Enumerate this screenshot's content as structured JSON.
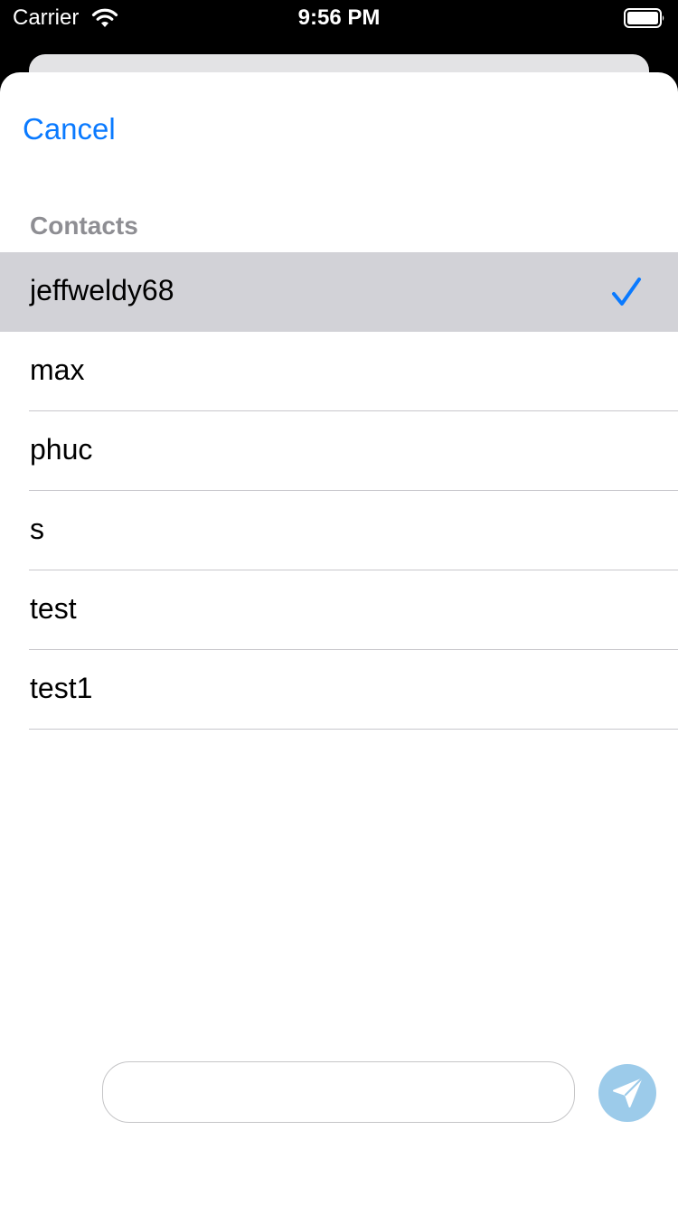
{
  "status_bar": {
    "carrier": "Carrier",
    "time": "9:56 PM",
    "wifi_icon": "wifi-icon",
    "battery_icon": "battery-icon"
  },
  "header": {
    "cancel_label": "Cancel"
  },
  "contacts": {
    "section_title": "Contacts",
    "items": [
      {
        "name": "jeffweldy68",
        "selected": true
      },
      {
        "name": "max",
        "selected": false
      },
      {
        "name": "phuc",
        "selected": false
      },
      {
        "name": "s",
        "selected": false
      },
      {
        "name": "test",
        "selected": false
      },
      {
        "name": "test1",
        "selected": false
      }
    ]
  },
  "composer": {
    "message_value": "",
    "placeholder": "",
    "send_icon": "send-icon"
  },
  "colors": {
    "accent": "#0a7aff",
    "selected_row": "#d2d2d7",
    "send_button": "#9ccbea",
    "section_header": "#8e8e93"
  }
}
